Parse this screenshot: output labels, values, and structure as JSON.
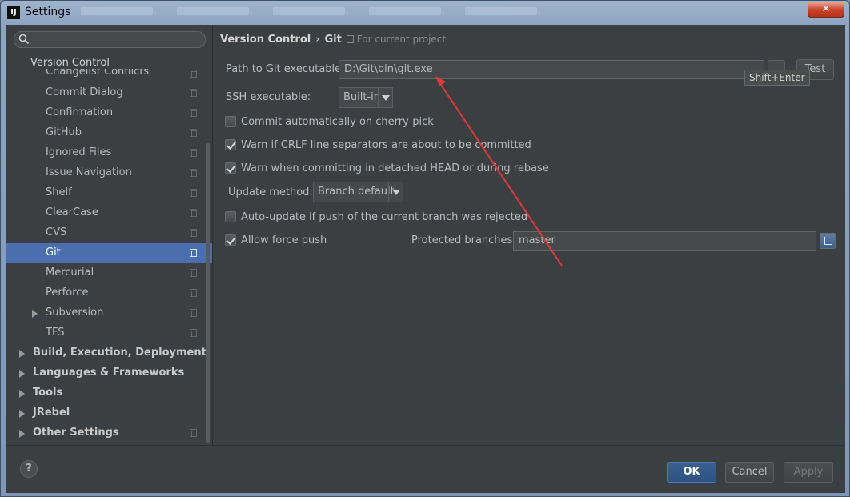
{
  "window": {
    "title": "Settings",
    "app_icon": "IJ",
    "close_symbol": "✕"
  },
  "sidebar": {
    "search": {
      "placeholder": "",
      "value": ""
    },
    "section_header": "Version Control",
    "children": [
      {
        "label": "Changelist Conflicts"
      },
      {
        "label": "Commit Dialog"
      },
      {
        "label": "Confirmation"
      },
      {
        "label": "GitHub"
      },
      {
        "label": "Ignored Files"
      },
      {
        "label": "Issue Navigation"
      },
      {
        "label": "Shelf"
      },
      {
        "label": "ClearCase"
      },
      {
        "label": "CVS"
      },
      {
        "label": "Git",
        "selected": true
      },
      {
        "label": "Mercurial"
      },
      {
        "label": "Perforce"
      },
      {
        "label": "Subversion",
        "expandable": true
      },
      {
        "label": "TFS"
      }
    ],
    "top_level": [
      {
        "label": "Build, Execution, Deployment"
      },
      {
        "label": "Languages & Frameworks"
      },
      {
        "label": "Tools"
      },
      {
        "label": "JRebel"
      },
      {
        "label": "Other Settings"
      }
    ]
  },
  "main": {
    "breadcrumb": {
      "parent": "Version Control",
      "separator": "›",
      "current": "Git",
      "scope": "For current project"
    },
    "git_path": {
      "label": "Path to Git executable:",
      "value": "D:\\Git\\bin\\git.exe",
      "test_label": "Test",
      "tooltip": "Shift+Enter"
    },
    "ssh": {
      "label": "SSH executable:",
      "value": "Built-in"
    },
    "checkboxes": [
      {
        "label": "Commit automatically on cherry-pick",
        "checked": false
      },
      {
        "label": "Warn if CRLF line separators are about to be committed",
        "checked": true
      },
      {
        "label": "Warn when committing in detached HEAD or during rebase",
        "checked": true
      }
    ],
    "update_method": {
      "label": "Update method:",
      "value": "Branch default"
    },
    "auto_update": {
      "label": "Auto-update if push of the current branch was rejected",
      "checked": false
    },
    "force_push": {
      "label": "Allow force push",
      "checked": true
    },
    "protected_branches": {
      "label": "Protected branches:",
      "value": "master"
    }
  },
  "footer": {
    "help": "?",
    "ok": "OK",
    "cancel": "Cancel",
    "apply": "Apply"
  },
  "colors": {
    "selection": "#4b6eaf",
    "annotation_arrow": "#e03a3a",
    "background": "#3c3f41"
  }
}
